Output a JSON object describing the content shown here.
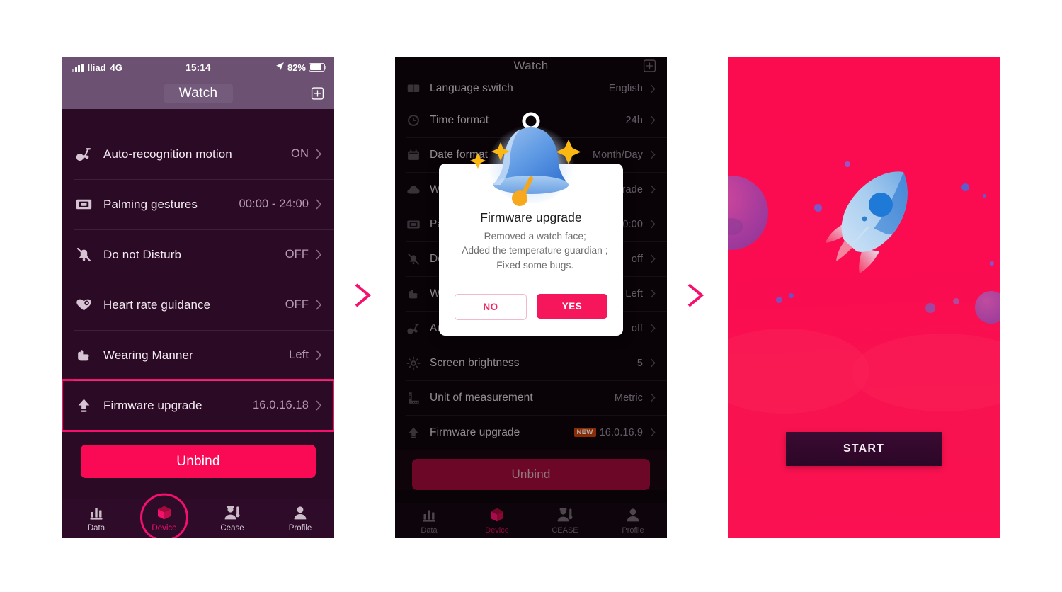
{
  "colors": {
    "accent_pink": "#f5106e",
    "unbind_pink": "#fa0a55",
    "screen1_bg": "#2b0a26",
    "screen1_header": "#6d5173",
    "screen2_bg": "#0d050c",
    "screen3_bg": "#fb0c4f",
    "start_btn": "#2c0726",
    "new_badge": "#c4400a"
  },
  "flow": {
    "arrow_1": "chevron-right",
    "arrow_2": "chevron-right"
  },
  "screen1": {
    "statusbar": {
      "carrier": "Iliad",
      "network": "4G",
      "time": "15:14",
      "battery": "82%",
      "location_icon": "location-arrow-icon",
      "signal_icon": "signal-bars-icon",
      "battery_icon": "battery-icon"
    },
    "navbar": {
      "title": "Watch",
      "add_icon": "plus-box-icon"
    },
    "rows": [
      {
        "icon": "exercise-bike-icon",
        "label": "Auto-recognition motion",
        "value": "ON",
        "highlight": false
      },
      {
        "icon": "palm-gesture-icon",
        "label": "Palming gestures",
        "value": "00:00 - 24:00",
        "highlight": false
      },
      {
        "icon": "bell-off-icon",
        "label": "Do not Disturb",
        "value": "OFF",
        "highlight": false
      },
      {
        "icon": "heart-rate-icon",
        "label": "Heart rate guidance",
        "value": "OFF",
        "highlight": false
      },
      {
        "icon": "hand-wear-icon",
        "label": "Wearing Manner",
        "value": "Left",
        "highlight": false
      },
      {
        "icon": "upload-arrow-icon",
        "label": "Firmware upgrade",
        "value": "16.0.16.18",
        "highlight": true
      }
    ],
    "unbind_label": "Unbind",
    "tabs": [
      {
        "icon": "bar-chart-icon",
        "label": "Data",
        "active": false,
        "selected_ring": false
      },
      {
        "icon": "cube-icon",
        "label": "Device",
        "active": true,
        "selected_ring": true
      },
      {
        "icon": "worker-icon",
        "label": "Cease",
        "active": false,
        "selected_ring": false
      },
      {
        "icon": "person-icon",
        "label": "Profile",
        "active": false,
        "selected_ring": false
      }
    ]
  },
  "screen2": {
    "navbar": {
      "title": "Watch",
      "add_icon": "plus-box-icon"
    },
    "rows": [
      {
        "icon": "book-icon",
        "label": "Language switch",
        "value": "English",
        "badge": ""
      },
      {
        "icon": "clock-icon",
        "label": "Time format",
        "value": "24h",
        "badge": ""
      },
      {
        "icon": "calendar-icon",
        "label": "Date format",
        "value": "Month/Day",
        "badge": ""
      },
      {
        "icon": "cloud-icon",
        "label": "Weather",
        "value": "Upgrade",
        "badge": ""
      },
      {
        "icon": "palm-gesture-icon",
        "label": "Palming gestures",
        "value": "00:00",
        "badge": ""
      },
      {
        "icon": "bell-off-icon",
        "label": "Do not Disturb",
        "value": "off",
        "badge": ""
      },
      {
        "icon": "hand-wear-icon",
        "label": "Wearing Manner",
        "value": "Left",
        "badge": ""
      },
      {
        "icon": "exercise-bike-icon",
        "label": "Auto-recognition",
        "value": "off",
        "badge": ""
      },
      {
        "icon": "brightness-icon",
        "label": "Screen brightness",
        "value": "5",
        "badge": ""
      },
      {
        "icon": "ruler-icon",
        "label": "Unit of measurement",
        "value": "Metric",
        "badge": ""
      },
      {
        "icon": "upload-arrow-icon",
        "label": "Firmware upgrade",
        "value": "16.0.16.9",
        "badge": "NEW"
      }
    ],
    "unbind_label": "Unbind",
    "tabs": [
      {
        "icon": "bar-chart-icon",
        "label": "Data",
        "active": false
      },
      {
        "icon": "cube-icon",
        "label": "Device",
        "active": true
      },
      {
        "icon": "worker-icon",
        "label": "CEASE",
        "active": false
      },
      {
        "icon": "person-icon",
        "label": "Profile",
        "active": false
      }
    ],
    "dialog": {
      "illustration": "bell-sparkles-icon",
      "title": "Firmware upgrade",
      "body": "– Removed a watch face;\n– Added the temperature guardian ;\n– Fixed some bugs.",
      "no_label": "NO",
      "yes_label": "YES"
    }
  },
  "screen3": {
    "illustration": "rocket-icon",
    "start_label": "START"
  }
}
